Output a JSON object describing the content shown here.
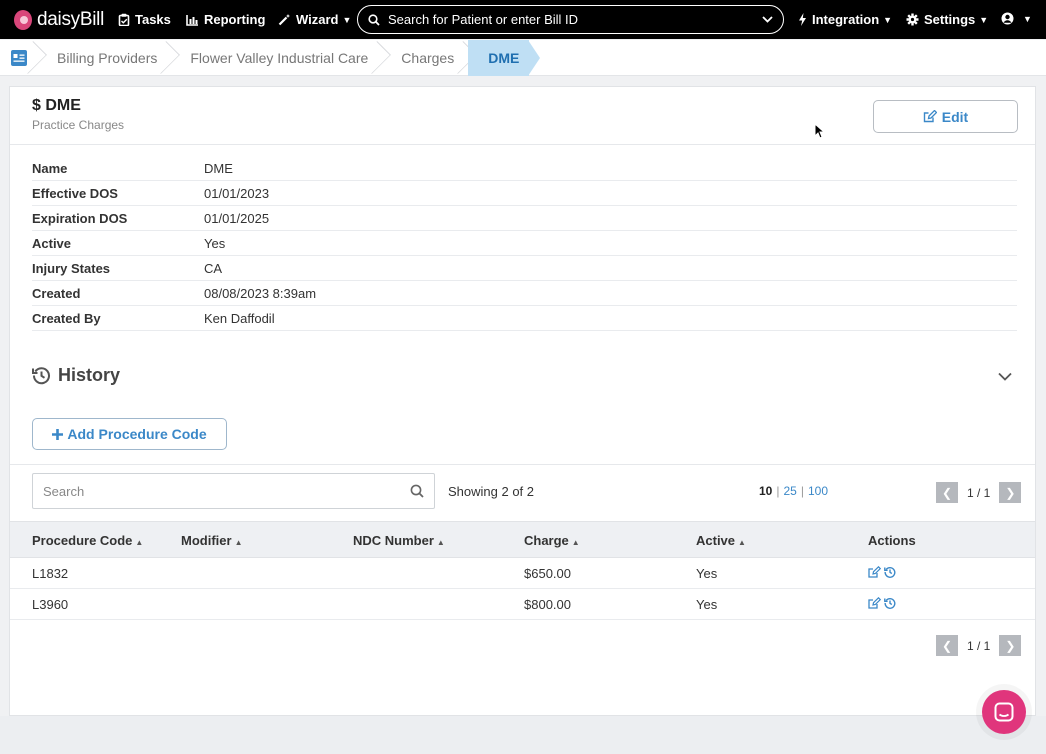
{
  "nav": {
    "brand": "daisyBill",
    "tasks": "Tasks",
    "reporting": "Reporting",
    "wizard": "Wizard",
    "search_placeholder": "Search for Patient or enter Bill ID",
    "integration": "Integration",
    "settings": "Settings"
  },
  "breadcrumb": [
    "Billing Providers",
    "Flower Valley Industrial Care",
    "Charges",
    "DME"
  ],
  "header": {
    "title": "$ DME",
    "subtitle": "Practice Charges",
    "edit_label": "Edit"
  },
  "details": [
    {
      "label": "Name",
      "value": "DME"
    },
    {
      "label": "Effective DOS",
      "value": "01/01/2023"
    },
    {
      "label": "Expiration DOS",
      "value": "01/01/2025"
    },
    {
      "label": "Active",
      "value": "Yes"
    },
    {
      "label": "Injury States",
      "value": "CA"
    },
    {
      "label": "Created",
      "value": "08/08/2023 8:39am"
    },
    {
      "label": "Created By",
      "value": "Ken Daffodil"
    }
  ],
  "history": {
    "title": "History"
  },
  "add_button": "Add Procedure Code",
  "table": {
    "search_placeholder": "Search",
    "showing": "Showing 2 of 2",
    "page_sizes": {
      "current": "10",
      "opt2": "25",
      "opt3": "100"
    },
    "page": "1 / 1",
    "columns": {
      "code": "Procedure Code",
      "modifier": "Modifier",
      "ndc": "NDC Number",
      "charge": "Charge",
      "active": "Active",
      "actions": "Actions"
    },
    "rows": [
      {
        "code": "L1832",
        "modifier": "",
        "ndc": "",
        "charge": "$650.00",
        "active": "Yes"
      },
      {
        "code": "L3960",
        "modifier": "",
        "ndc": "",
        "charge": "$800.00",
        "active": "Yes"
      }
    ]
  },
  "colors": {
    "nav_bg": "#000000",
    "accent": "#3b88c8",
    "breadcrumb_active": "#bfdff4",
    "chat": "#e0357c"
  }
}
